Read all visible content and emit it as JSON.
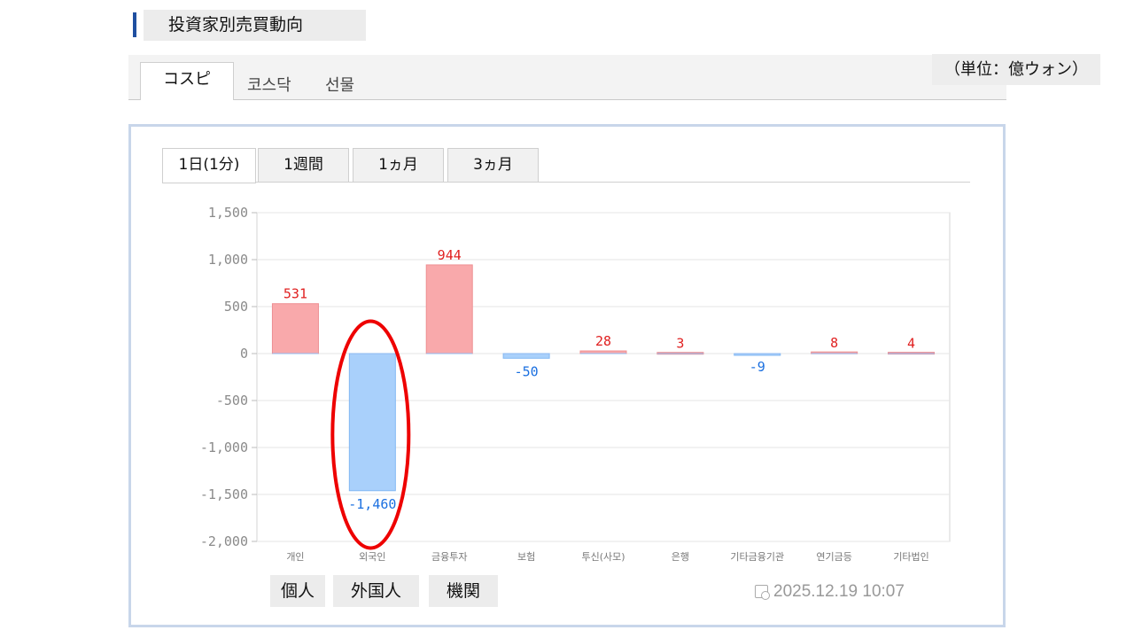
{
  "header": {
    "title": "投資家別売買動向"
  },
  "market_tabs": [
    "コスピ",
    "코스닥",
    "선물"
  ],
  "unit_label": "（単位：億ウォン）",
  "period_tabs": [
    "1日(1分)",
    "1週間",
    "1ヵ月",
    "3ヵ月"
  ],
  "investor_groups": [
    "個人",
    "外国人",
    "機関"
  ],
  "timestamp": "2025.12.19 10:07",
  "colors": {
    "positive": "#f9a9ab",
    "negative": "#a9d0fb",
    "positive_text": "#e02020",
    "negative_text": "#1a6fe0",
    "highlight": "#ee0000"
  },
  "chart_data": {
    "type": "bar",
    "categories": [
      "개인",
      "외국인",
      "금융투자",
      "보험",
      "투신(사모)",
      "은행",
      "기타금융기관",
      "연기금등",
      "기타법인"
    ],
    "values": [
      531,
      -1460,
      944,
      -50,
      28,
      3,
      -9,
      8,
      4
    ],
    "value_labels": [
      "531",
      "-1,460",
      "944",
      "-50",
      "28",
      "3",
      "-9",
      "8",
      "4"
    ],
    "ylim": [
      -2000,
      1500
    ],
    "yticks": [
      1500,
      1000,
      500,
      0,
      -500,
      -1000,
      -1500,
      -2000
    ],
    "ytick_labels": [
      "1,500",
      "1,000",
      "500",
      "0",
      "-500",
      "-1,000",
      "-1,500",
      "-2,000"
    ],
    "grid": true,
    "highlighted_category": "외국인"
  }
}
